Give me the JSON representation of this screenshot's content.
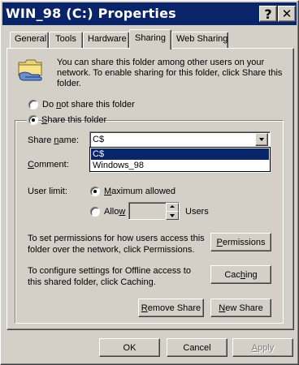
{
  "window": {
    "title": "WIN_98 (C:) Properties",
    "help_label": "?",
    "close_label": "✕",
    "titlebar_color": "#0a246a"
  },
  "tabs": [
    {
      "label": "General"
    },
    {
      "label": "Tools"
    },
    {
      "label": "Hardware"
    },
    {
      "label": "Sharing",
      "active": true
    },
    {
      "label": "Web Sharing"
    }
  ],
  "sharing": {
    "icon": "shared-folder-hand-icon",
    "description": [
      "You can share this folder among other users on your",
      "network.  To enable sharing for this folder, click Share this",
      "folder."
    ],
    "do_not_share": {
      "pre": "Do ",
      "ul": "n",
      "post": "ot share this folder",
      "selected": false
    },
    "share": {
      "pre": "",
      "ul": "S",
      "post": "hare this folder",
      "selected": true
    },
    "share_name": {
      "pre": "Share ",
      "ul": "n",
      "post": "ame:",
      "value": "C$"
    },
    "share_name_options": [
      "C$",
      "Windows_98"
    ],
    "comment": {
      "pre": "",
      "ul": "C",
      "post": "omment:"
    },
    "user_limit": {
      "label": "User limit:",
      "maximum": {
        "pre": "",
        "ul": "M",
        "post": "aximum allowed",
        "selected": true
      },
      "allow": {
        "pre": "Allo",
        "ul": "w",
        "post": "",
        "selected": false
      },
      "allow_value": "",
      "users_label": "Users"
    },
    "permissions": {
      "text": [
        "To set permissions for how users access this",
        "folder over the network, click Permissions."
      ],
      "button": {
        "pre": "",
        "ul": "P",
        "post": "ermissions"
      }
    },
    "caching": {
      "text": [
        "To configure settings for Offline access to",
        "this shared folder, click Caching."
      ],
      "button": {
        "pre": "Cac",
        "ul": "h",
        "post": "ing"
      }
    },
    "remove_share": {
      "pre": "",
      "ul": "R",
      "post": "emove Share"
    },
    "new_share": {
      "pre": "",
      "ul": "N",
      "post": "ew Share"
    }
  },
  "footer": {
    "ok": "OK",
    "cancel": "Cancel",
    "apply": {
      "pre": "",
      "ul": "A",
      "post": "pply"
    }
  }
}
